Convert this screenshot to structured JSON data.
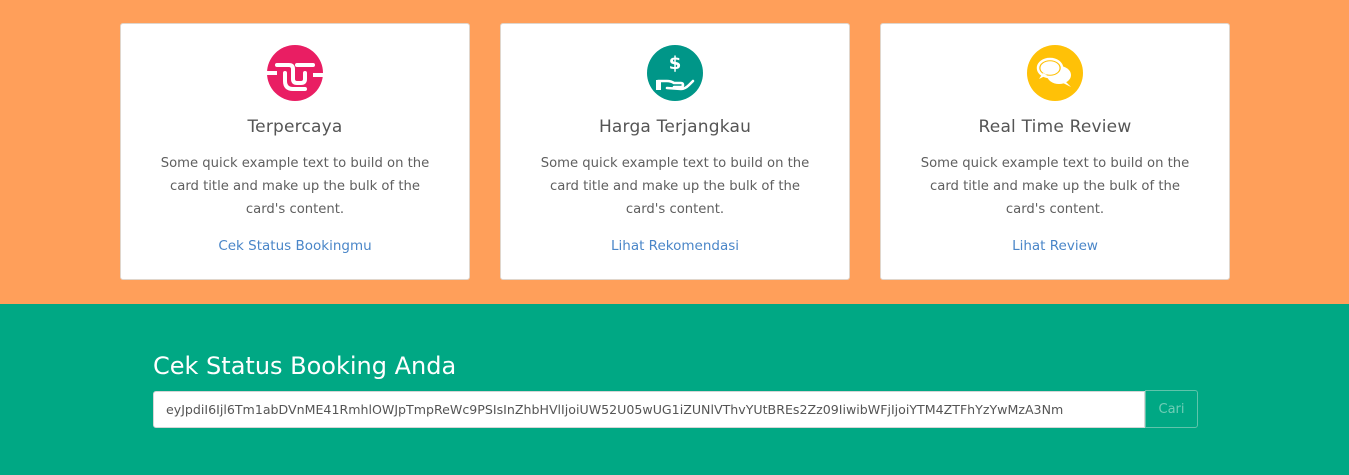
{
  "features": {
    "cards": [
      {
        "icon": "handshake-icon",
        "icon_color": "#e91e63",
        "title": "Terpercaya",
        "text": "Some quick example text to build on the card title and make up the bulk of the card's content.",
        "link": "Cek Status Bookingmu"
      },
      {
        "icon": "hand-dollar-icon",
        "icon_color": "#009688",
        "title": "Harga Terjangkau",
        "text": "Some quick example text to build on the card title and make up the bulk of the card's content.",
        "link": "Lihat Rekomendasi"
      },
      {
        "icon": "chat-bubbles-icon",
        "icon_color": "#ffc107",
        "title": "Real Time Review",
        "text": "Some quick example text to build on the card title and make up the bulk of the card's content.",
        "link": "Lihat Review"
      }
    ]
  },
  "booking": {
    "title": "Cek Status Booking Anda",
    "input_value": "eyJpdiI6Ijl6Tm1abDVnME41RmhlOWJpTmpReWc9PSIsInZhbHVlIjoiUW52U05wUG1iZUNlVThvYUtBREs2Zz09IiwibWFjIjoiYTM4ZTFhYzYwMzA3Nm",
    "button_label": "Cari"
  },
  "colors": {
    "top_background": "#ff9f5a",
    "bottom_background": "#00a884",
    "link": "#4a86c8"
  }
}
